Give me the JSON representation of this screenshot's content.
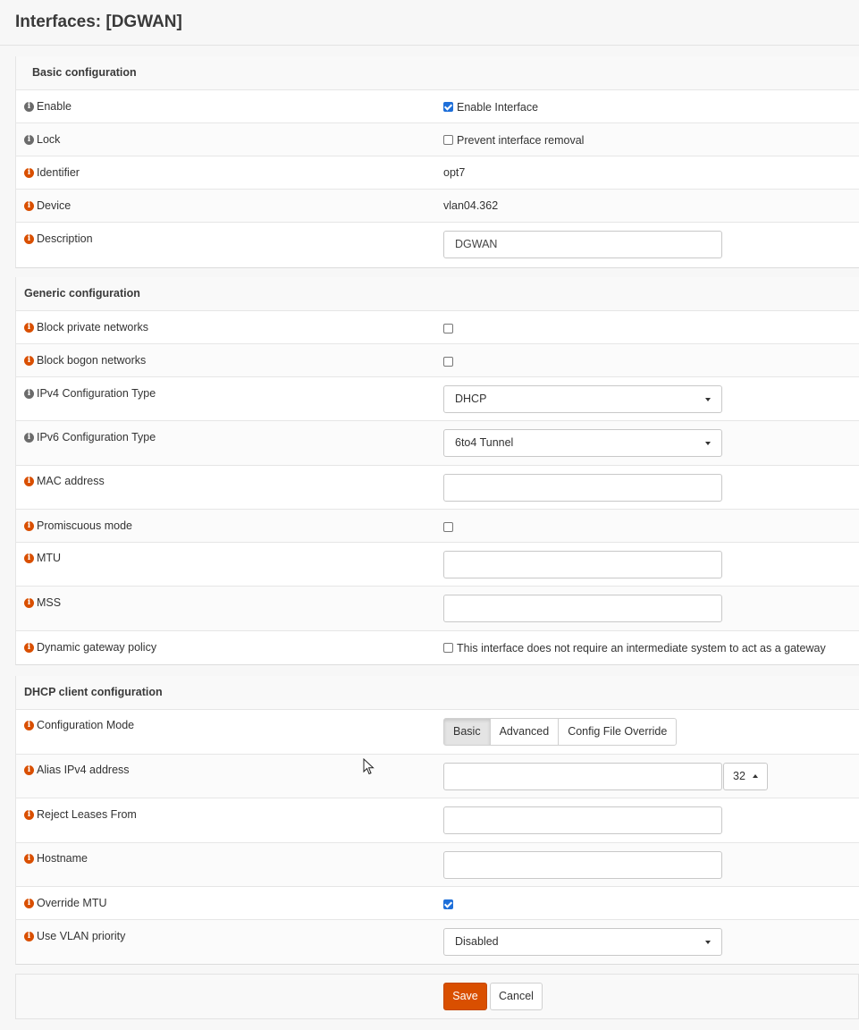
{
  "page": {
    "title": "Interfaces: [DGWAN]"
  },
  "basic": {
    "header": "Basic configuration",
    "enable_label": "Enable",
    "enable_cb_label": "Enable Interface",
    "lock_label": "Lock",
    "lock_cb_label": "Prevent interface removal",
    "identifier_label": "Identifier",
    "identifier_value": "opt7",
    "device_label": "Device",
    "device_value": "vlan04.362",
    "description_label": "Description",
    "description_value": "DGWAN"
  },
  "generic": {
    "header": "Generic configuration",
    "block_private_label": "Block private networks",
    "block_bogon_label": "Block bogon networks",
    "ipv4_label": "IPv4 Configuration Type",
    "ipv4_value": "DHCP",
    "ipv6_label": "IPv6 Configuration Type",
    "ipv6_value": "6to4 Tunnel",
    "mac_label": "MAC address",
    "mac_value": "",
    "promisc_label": "Promiscuous mode",
    "mtu_label": "MTU",
    "mtu_value": "",
    "mss_label": "MSS",
    "mss_value": "",
    "dyngw_label": "Dynamic gateway policy",
    "dyngw_cb_label": "This interface does not require an intermediate system to act as a gateway"
  },
  "dhcp": {
    "header": "DHCP client configuration",
    "mode_label": "Configuration Mode",
    "mode_options": [
      "Basic",
      "Advanced",
      "Config File Override"
    ],
    "mode_selected": "Basic",
    "alias_label": "Alias IPv4 address",
    "alias_value": "",
    "alias_prefix": "32",
    "reject_label": "Reject Leases From",
    "reject_value": "",
    "hostname_label": "Hostname",
    "hostname_value": "",
    "override_mtu_label": "Override MTU",
    "vlan_prio_label": "Use VLAN priority",
    "vlan_prio_value": "Disabled"
  },
  "footer": {
    "save_label": "Save",
    "cancel_label": "Cancel"
  },
  "colors": {
    "accent": "#d94f00",
    "checkbox": "#1e6fd9"
  },
  "icons": {
    "info": "info-icon",
    "caret": "chevron-down-icon"
  }
}
